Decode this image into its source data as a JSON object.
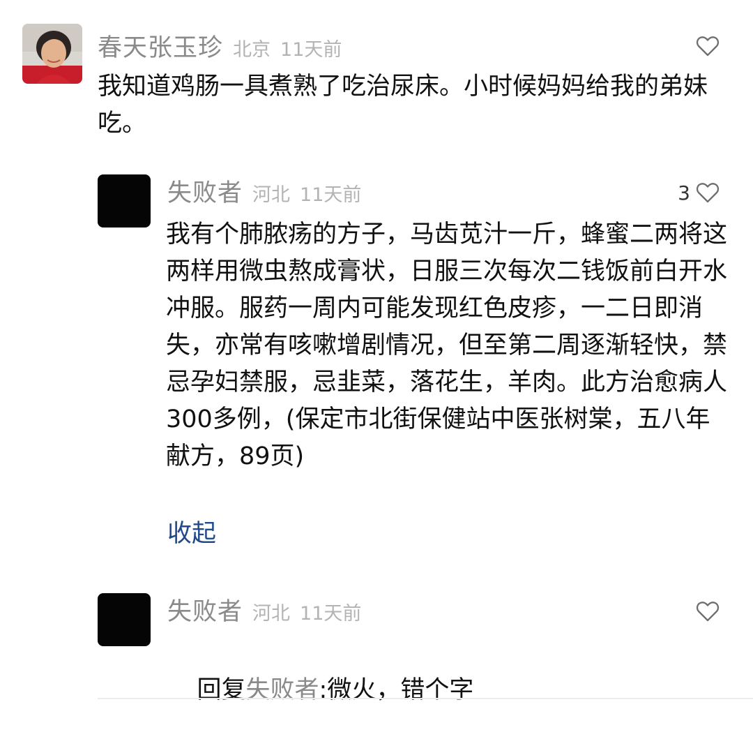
{
  "comments": [
    {
      "username": "春天张玉珍",
      "location": "北京",
      "time": "11天前",
      "likes": "",
      "text": "我知道鸡肠一具煮熟了吃治尿床。小时候妈妈给我的弟妹吃。"
    },
    {
      "username": "失败者",
      "location": "河北",
      "time": "11天前",
      "likes": "3",
      "text": "我有个肺脓疡的方子，马齿苋汁一斤，蜂蜜二两将这两样用微虫熬成膏状，日服三次每次二钱饭前白开水冲服。服药一周内可能发现红色皮疹，一二日即消失，亦常有咳嗽增剧情况，但至第二周逐渐轻快，禁忌孕妇禁服，忌韭菜，落花生，羊肉。此方治愈病人300多例，(保定市北街保健站中医张树棠，五八年献方，89页)",
      "collapse_label": "收起"
    },
    {
      "username": "失败者",
      "location": "河北",
      "time": "11天前",
      "likes": "",
      "reply_prefix": "回复",
      "reply_target": "失败者",
      "reply_text": ":微火，错个字"
    }
  ],
  "icons": {
    "like": "heart-outline-icon"
  },
  "colors": {
    "username": "#8a8a8a",
    "meta": "#b3b3b3",
    "link": "#1f4a8c"
  }
}
